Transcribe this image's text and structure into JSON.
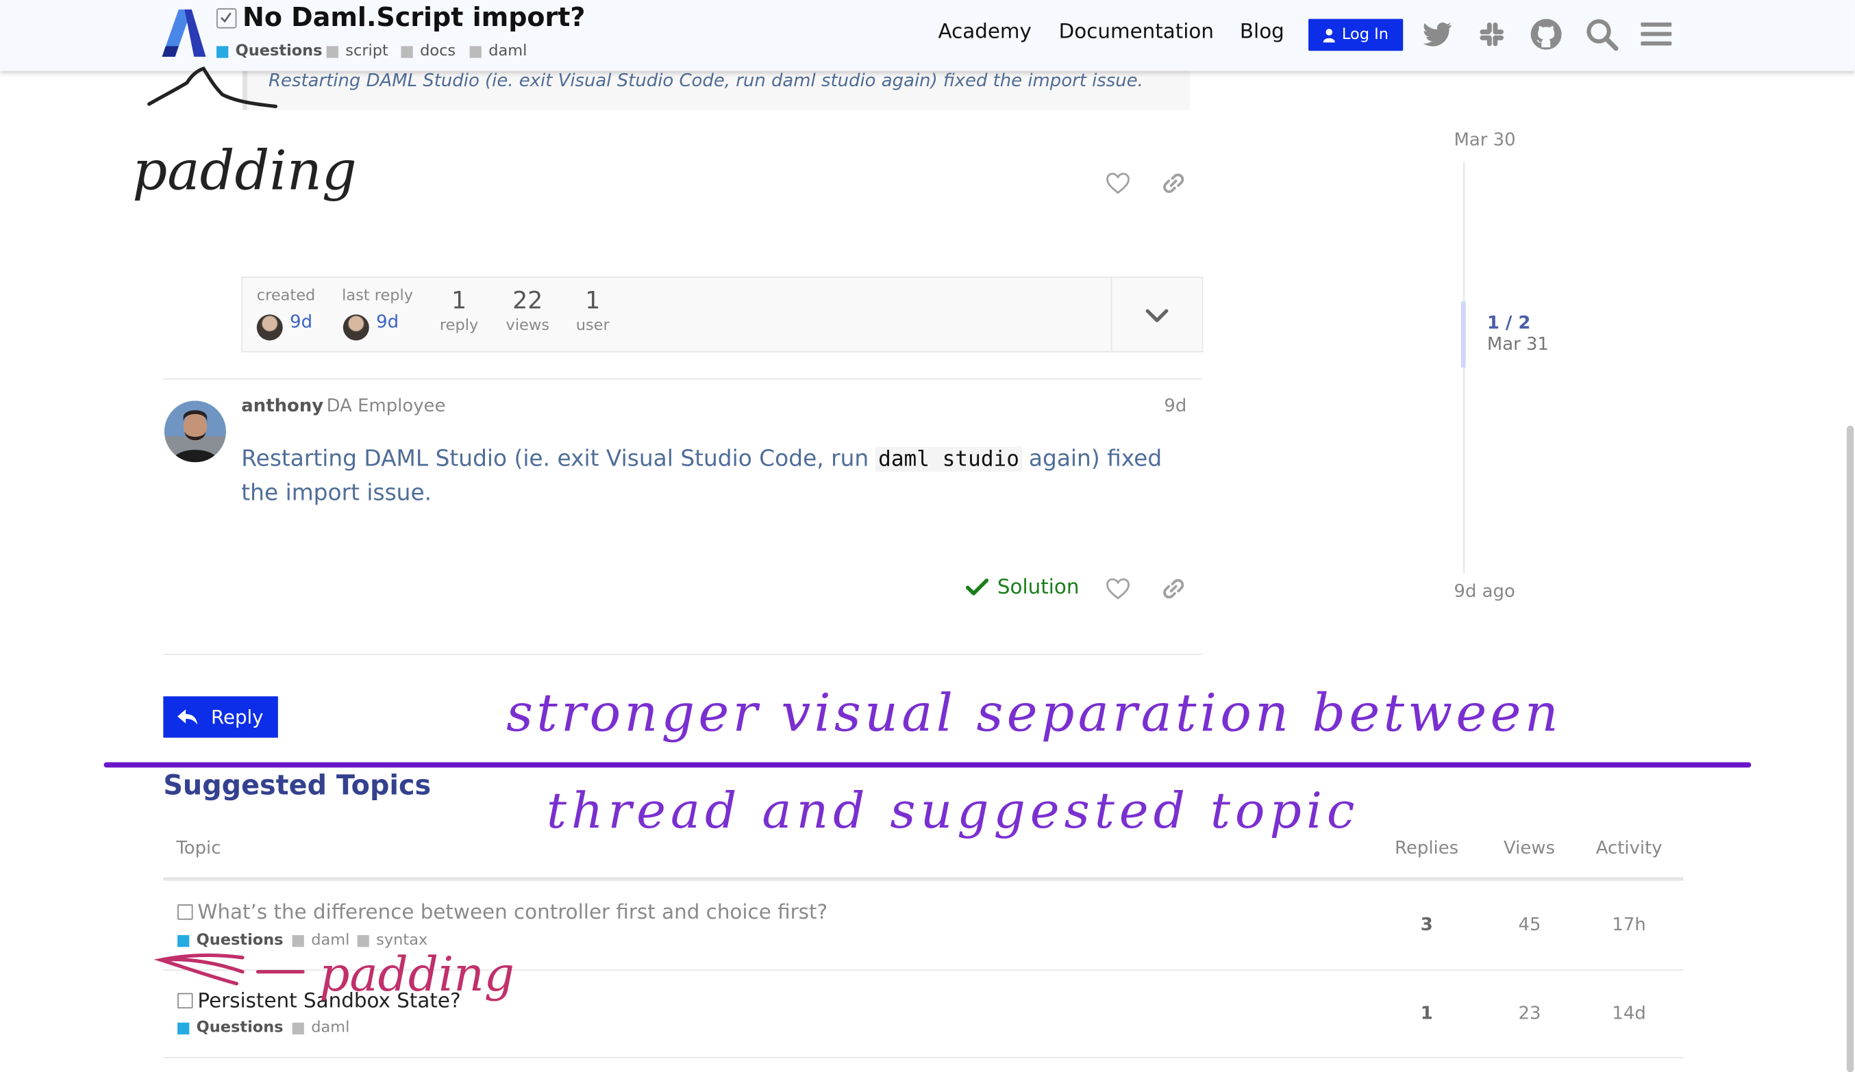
{
  "header": {
    "title": "No Daml.Script import?",
    "category": "Questions",
    "tags": [
      "script",
      "docs",
      "daml"
    ],
    "nav": [
      "Academy",
      "Documentation",
      "Blog"
    ],
    "login_label": "Log In",
    "icons": [
      "twitter-icon",
      "slack-icon",
      "github-icon",
      "search-icon",
      "hamburger-menu-icon"
    ],
    "colors": {
      "accent": "#0c2ee8",
      "category": "#25aae1"
    }
  },
  "quote": {
    "text": "Restarting DAML Studio (ie. exit Visual Studio Code, run daml studio again) fixed the import issue."
  },
  "topic_map": {
    "created_label": "created",
    "created_age": "9d",
    "last_reply_label": "last reply",
    "last_reply_age": "9d",
    "replies_count": "1",
    "replies_label": "reply",
    "views_count": "22",
    "views_label": "views",
    "users_count": "1",
    "users_label": "user"
  },
  "post": {
    "author": "anthony",
    "author_title": "DA Employee",
    "age": "9d",
    "body_before": "Restarting DAML Studio (ie. exit Visual Studio Code, run ",
    "body_code": "daml studio",
    "body_after": " again) fixed the import issue.",
    "solution_label": "Solution"
  },
  "timeline": {
    "top_date": "Mar 30",
    "position": "1 / 2",
    "position_date": "Mar 31",
    "bottom_date": "9d ago"
  },
  "reply_label": "Reply",
  "suggested": {
    "heading": "Suggested Topics",
    "columns": [
      "Topic",
      "Replies",
      "Views",
      "Activity"
    ],
    "rows": [
      {
        "title": "What’s the difference between controller first and choice first?",
        "category": "Questions",
        "tags": [
          "daml",
          "syntax"
        ],
        "replies": "3",
        "views": "45",
        "activity": "17h"
      },
      {
        "title": "Persistent Sandbox State?",
        "category": "Questions",
        "tags": [
          "daml"
        ],
        "replies": "1",
        "views": "23",
        "activity": "14d"
      }
    ]
  },
  "annotations": {
    "note_padding_top": "padding",
    "note_separation_line1": "stronger visual separation between",
    "note_separation_line2": "thread and suggested topic",
    "note_padding_bottom": "padding",
    "colors": {
      "purple": "#7a2fd0",
      "violet_line": "#6a17c9",
      "pink": "#c0306a",
      "black": "#222222"
    }
  }
}
